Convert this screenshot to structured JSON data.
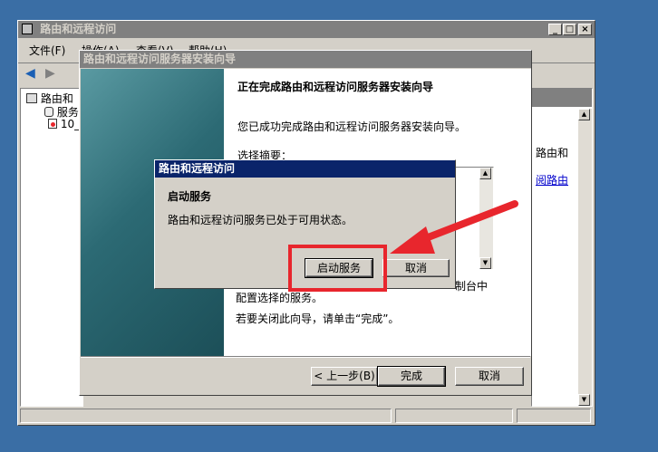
{
  "main_window": {
    "title": "路由和远程访问",
    "menu": [
      "文件(F)",
      "操作(A)",
      "查看(V)",
      "帮助(H)"
    ],
    "tree": [
      "路由和",
      "服务",
      "10_"
    ],
    "right_text": [
      "路由和",
      "阅路由"
    ]
  },
  "wizard": {
    "title": "路由和远程访问服务器安装向导",
    "heading": "正在完成路由和远程访问服务器安装向导",
    "intro": "您已成功完成路由和远程访问服务器安装向导。",
    "summary_label": "选择摘要：",
    "line_partial": "制台中",
    "line_config": "配置选择的服务。",
    "line_close": "若要关闭此向导，请单击“完成”。",
    "back_label": "< 上一步(B)",
    "finish_label": "完成",
    "cancel_label": "取消"
  },
  "dialog": {
    "title": "路由和远程访问",
    "heading": "启动服务",
    "message": "路由和远程访问服务已处于可用状态。",
    "start_label": "启动服务",
    "cancel_label": "取消"
  },
  "colors": {
    "annotation": "#e8262d",
    "title_active": "#0a246a",
    "desktop": "#3a6ea5"
  }
}
